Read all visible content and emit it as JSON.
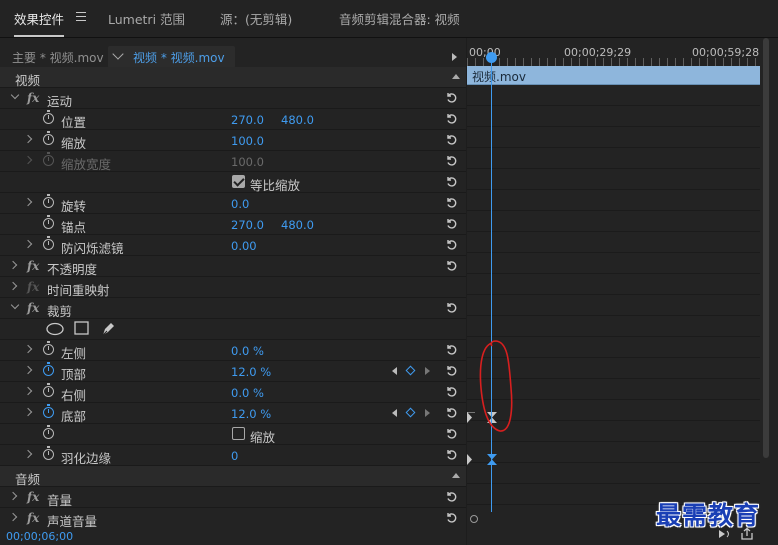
{
  "tabs": [
    {
      "label": "效果控件"
    },
    {
      "label": "Lumetri 范围"
    },
    {
      "label": "源：(无剪辑)"
    },
    {
      "label": "音频剪辑混合器: 视频"
    }
  ],
  "clip_bar": {
    "master": "主要 * 视频.mov",
    "sequence": "视频 * 视频.mov"
  },
  "sections": {
    "video": "视频",
    "audio": "音频"
  },
  "effects": {
    "motion": "运动",
    "position": {
      "label": "位置",
      "x": "270.0",
      "y": "480.0"
    },
    "scale": {
      "label": "缩放",
      "value": "100.0"
    },
    "scale_width": {
      "label": "缩放宽度",
      "value": "100.0"
    },
    "uniform_scale": {
      "label": "等比缩放",
      "checked": true
    },
    "rotation": {
      "label": "旋转",
      "value": "0.0"
    },
    "anchor": {
      "label": "锚点",
      "x": "270.0",
      "y": "480.0"
    },
    "flicker": {
      "label": "防闪烁滤镜",
      "value": "0.00"
    },
    "opacity": "不透明度",
    "time_remap": "时间重映射",
    "crop": "裁剪",
    "crop_left": {
      "label": "左侧",
      "value": "0.0 %"
    },
    "crop_top": {
      "label": "顶部",
      "value": "12.0 %"
    },
    "crop_right": {
      "label": "右侧",
      "value": "0.0 %"
    },
    "crop_bottom": {
      "label": "底部",
      "value": "12.0 %"
    },
    "crop_zoom": {
      "label": "缩放",
      "checked": false
    },
    "feather": {
      "label": "羽化边缘",
      "value": "0"
    },
    "volume": "音量",
    "channel_volume": "声道音量"
  },
  "timeline": {
    "timecodes": [
      "00;00",
      "00;00;29;29",
      "00;00;59;28"
    ],
    "clip_name": "视频.mov"
  },
  "status": {
    "timecode": "00;00;06;00"
  },
  "watermark": "最需教育",
  "colors": {
    "accent": "#3f9bf0",
    "clip": "#8eb6dc",
    "annotation": "#d81f1f",
    "watermark": "#1a3fb5"
  }
}
